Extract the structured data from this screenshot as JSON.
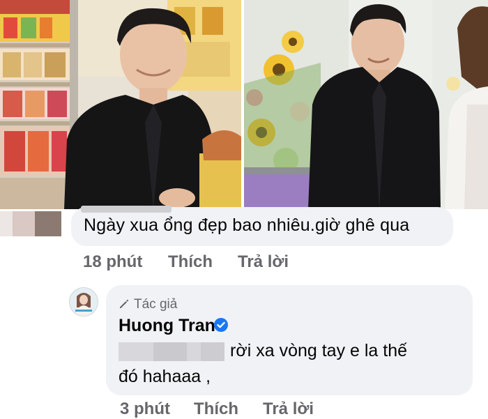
{
  "comment": {
    "text": "Ngày xua ổng đẹp bao nhiêu.giờ ghê qua",
    "time": "18 phút",
    "like_label": "Thích",
    "reply_label": "Trả lời"
  },
  "reply": {
    "badge_label": "Tác giả",
    "author_name": "Huong Tran",
    "text_line1": "rời xa vòng tay e la thế",
    "text_line2": "đó hahaaa ,",
    "time": "3 phút",
    "like_label": "Thích",
    "reply_label": "Trả lời"
  },
  "icons": {
    "badge": "pencil-icon",
    "verified": "verified-badge-icon"
  },
  "colors": {
    "bubble": "#f0f2f5",
    "secondary_text": "#65676b",
    "verified_blue": "#1877f2"
  }
}
